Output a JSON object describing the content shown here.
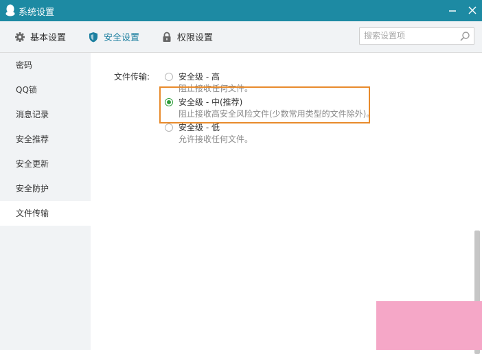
{
  "window": {
    "title": "系统设置"
  },
  "tabs": [
    {
      "label": "基本设置",
      "icon": "gear-icon"
    },
    {
      "label": "安全设置",
      "icon": "shield-icon",
      "active": true
    },
    {
      "label": "权限设置",
      "icon": "lock-icon"
    }
  ],
  "search": {
    "placeholder": "搜索设置项"
  },
  "sidebar": {
    "items": [
      {
        "label": "密码"
      },
      {
        "label": "QQ锁"
      },
      {
        "label": "消息记录"
      },
      {
        "label": "安全推荐"
      },
      {
        "label": "安全更新"
      },
      {
        "label": "安全防护"
      },
      {
        "label": "文件传输",
        "active": true
      }
    ]
  },
  "file_transfer": {
    "label": "文件传输:",
    "options": [
      {
        "title": "安全级 - 高",
        "desc": "阻止接收任何文件。",
        "checked": false
      },
      {
        "title": "安全级 - 中(推荐)",
        "desc": "阻止接收高安全风险文件(少数常用类型的文件除外)。",
        "checked": true
      },
      {
        "title": "安全级 - 低",
        "desc": "允许接收任何文件。",
        "checked": false
      }
    ]
  },
  "colors": {
    "titlebar": "#1d8aa3",
    "accent": "#1c7fa0",
    "highlight": "#e88a2b",
    "radio_checked": "#2e9e3a"
  }
}
